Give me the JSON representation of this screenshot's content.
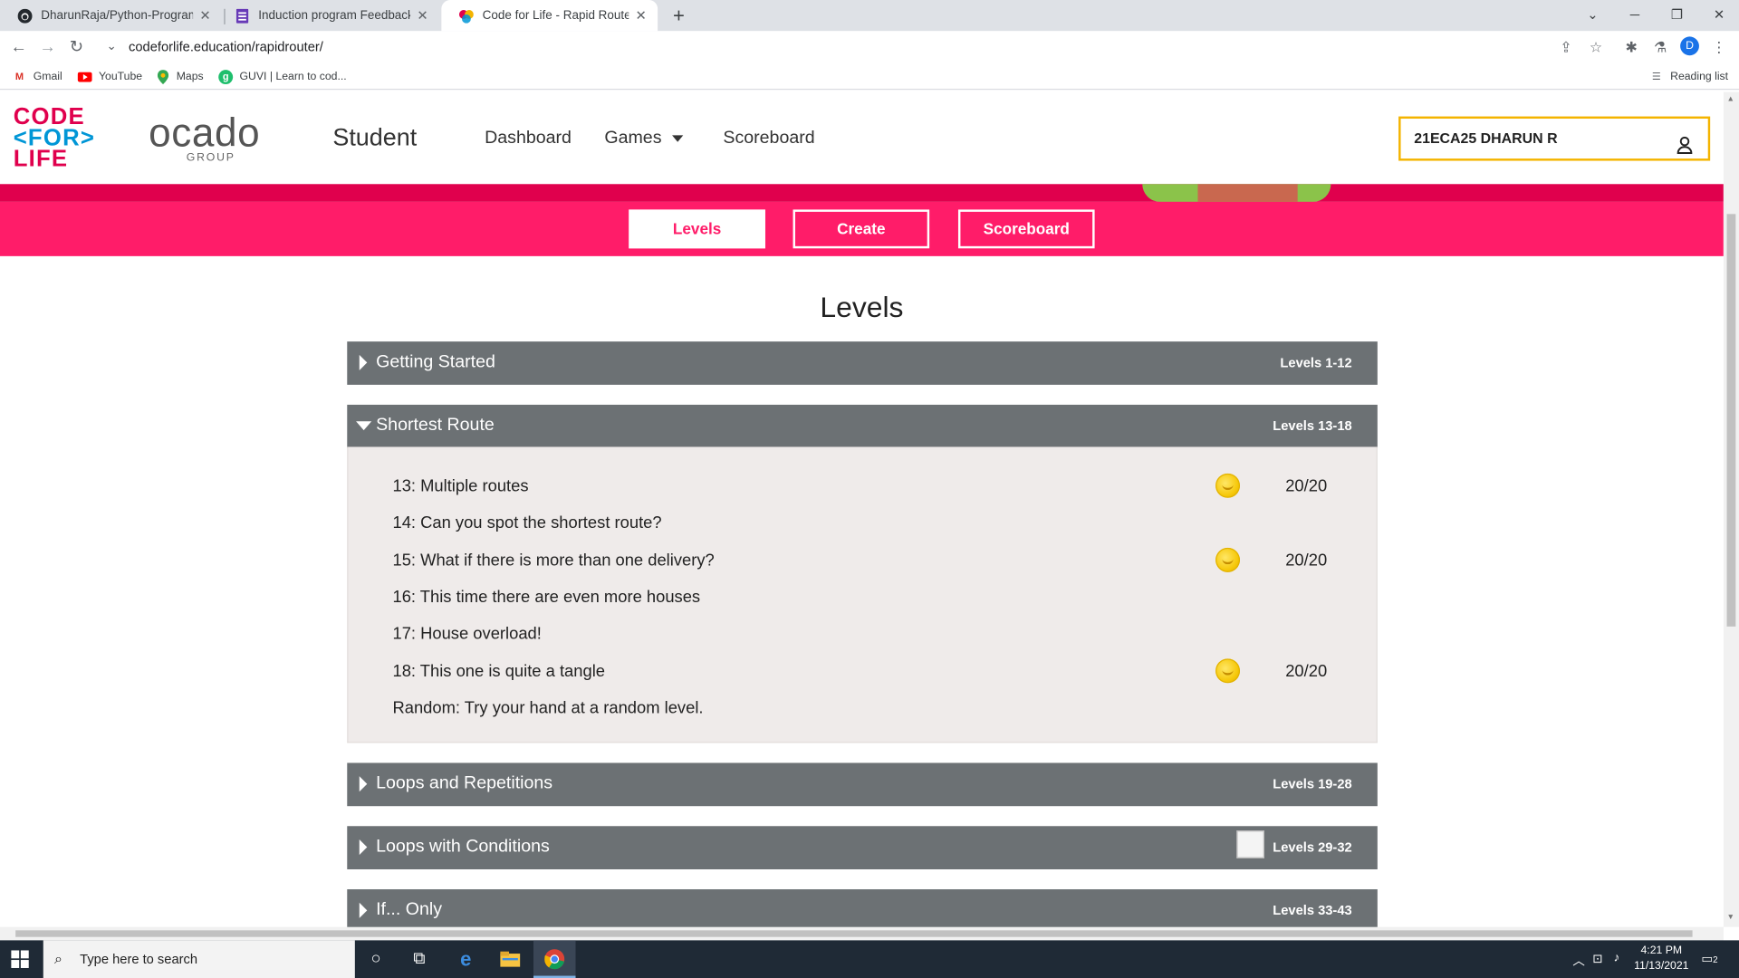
{
  "browser": {
    "tabs": [
      {
        "title": "DharunRaja/Python-Programmin",
        "favicon": "github-icon"
      },
      {
        "title": "Induction program Feedback",
        "favicon": "forms-icon"
      },
      {
        "title": "Code for Life - Rapid Router",
        "favicon": "codeforlife-icon"
      }
    ],
    "url": "codeforlife.education/rapidrouter/",
    "profile_initial": "D",
    "reading_list": "Reading list",
    "bookmarks": [
      {
        "label": "Gmail",
        "icon": "gmail-icon"
      },
      {
        "label": "YouTube",
        "icon": "youtube-icon"
      },
      {
        "label": "Maps",
        "icon": "maps-icon"
      },
      {
        "label": "GUVI | Learn to cod...",
        "icon": "guvi-icon"
      }
    ]
  },
  "header": {
    "logo_lines": [
      "CODE",
      "<FOR>",
      "LIFE"
    ],
    "partner_name": "ocado",
    "partner_sub": "GROUP",
    "section": "Student",
    "nav": {
      "dashboard": "Dashboard",
      "games": "Games",
      "scoreboard": "Scoreboard"
    },
    "user": "21ECA25 DHARUN R"
  },
  "subnav": {
    "levels": "Levels",
    "create": "Create",
    "scoreboard": "Scoreboard"
  },
  "page": {
    "heading": "Levels"
  },
  "episodes": [
    {
      "name": "Getting Started",
      "range": "Levels 1-12"
    },
    {
      "name": "Shortest Route",
      "range": "Levels 13-18"
    },
    {
      "name": "Loops and Repetitions",
      "range": "Levels 19-28"
    },
    {
      "name": "Loops with Conditions",
      "range": "Levels 29-32"
    },
    {
      "name": "If... Only",
      "range": "Levels 33-43"
    }
  ],
  "levels": [
    {
      "name": "13: Multiple routes",
      "score": "20/20",
      "coin": true
    },
    {
      "name": "14: Can you spot the shortest route?",
      "score": "",
      "coin": false
    },
    {
      "name": "15: What if there is more than one delivery?",
      "score": "20/20",
      "coin": true
    },
    {
      "name": "16: This time there are even more houses",
      "score": "",
      "coin": false
    },
    {
      "name": "17: House overload!",
      "score": "",
      "coin": false
    },
    {
      "name": "18: This one is quite a tangle",
      "score": "20/20",
      "coin": true
    },
    {
      "name": "Random: Try your hand at a random level.",
      "score": "",
      "coin": false
    }
  ],
  "colors": {
    "brand_pink": "#ff1c69",
    "episode_bar": "#6c7174",
    "user_border": "#f4b400"
  },
  "taskbar": {
    "search_placeholder": "Type here to search",
    "time": "4:21 PM",
    "date": "11/13/2021",
    "notifications": "2"
  }
}
